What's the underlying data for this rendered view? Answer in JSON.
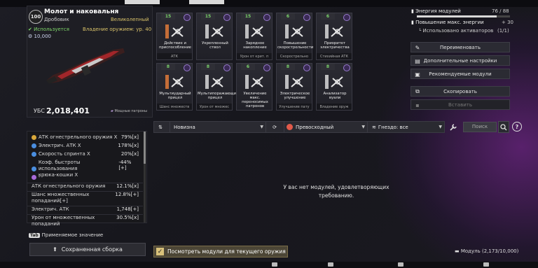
{
  "weapon": {
    "level": "100",
    "name": "Молот и наковальня",
    "type": "Дробовик",
    "rarity": "Великолепный",
    "in_use": "Используется",
    "mastery": "Владение оружием: ур. 40",
    "currency": "10,000",
    "ubs_label": "УБС",
    "ubs_value": "2,018,401",
    "ammo_type": "Мощные патроны"
  },
  "modules": [
    {
      "cap": "15",
      "name": "Действие и\nприспособление",
      "footer": "АТК"
    },
    {
      "cap": "15",
      "name": "Укрепленный\nствол",
      "footer": ""
    },
    {
      "cap": "15",
      "name": "Зарядное\nнакопление",
      "footer": "Урон от крит. п"
    },
    {
      "cap": "6",
      "name": "Повышение\nскорострельности",
      "footer": "Скорострельно"
    },
    {
      "cap": "6",
      "name": "Приоритет\nэлектричества",
      "footer": "Стихийная АТК"
    },
    {
      "cap": "8",
      "name": "Мультиударный\nприцел",
      "footer": "Шанс множеств"
    },
    {
      "cap": "8",
      "name": "Мультипоражающий\nприцел",
      "footer": "Урон от множес"
    },
    {
      "cap": "6",
      "name": "Увеличение\nмакс.\nпереносимых\nпатронов",
      "footer": ""
    },
    {
      "cap": "8",
      "name": "Электрическое\nулучшение",
      "footer": "Улучшение пату"
    },
    {
      "cap": "8",
      "name": "Анализатор\nвуали",
      "footer": "Владение оруж"
    }
  ],
  "stats": [
    {
      "label": "АТК огнестрельного оружия X",
      "value": "79%[x]",
      "icon": "gold"
    },
    {
      "label": "Электрич. АТК X",
      "value": "178%[x]",
      "icon": "blue"
    },
    {
      "label": "Скорость спринта X",
      "value": "20%[x]",
      "icon": "blue"
    },
    {
      "label": "Коэф. быстроты использования\nкрюка-кошки X",
      "value": "-44%[+]",
      "icon": "blue"
    },
    {
      "label": "-",
      "value": "",
      "icon": "purple"
    },
    {
      "label": "АТК огнестрельного оружия",
      "value": "12.1%[x]",
      "icon": ""
    },
    {
      "label": "Шанс множественных\nпопаданий[+]",
      "value": "12.8%[+]",
      "icon": ""
    },
    {
      "label": "Электрич. АТК",
      "value": "1,748[+]",
      "icon": ""
    },
    {
      "label": "Урон от множественных\nпопаданий",
      "value": "30.5%[x]",
      "icon": ""
    }
  ],
  "applied_value": {
    "key": "Tab",
    "label": "Применяемое значение"
  },
  "saved_build": "Сохраненная сборка",
  "right": {
    "energy_label": "Энергия модулей",
    "energy_value": "76 / 88",
    "energy_fraction": 0.86,
    "boost_label": "Повышение макс. энергии",
    "boost_value": "+ 30",
    "activators_label": "Использовано активаторов",
    "activators_value": "(1/1)",
    "buttons": [
      "Переименовать",
      "Дополнительные настройки",
      "Рекомендуемые модули",
      "Скопировать",
      "Вставить"
    ]
  },
  "filter": {
    "sort": "Новизна",
    "grade": "Превосходный",
    "socket": "Гнездо: все",
    "search_placeholder": "Поиск",
    "help": "?"
  },
  "empty_message": "У вас нет модулей, удовлетворяющих требованию.",
  "check_label": "Посмотреть модули для текущего оружия",
  "module_count": "Модуль (2,173/10,000)",
  "colors": {
    "accent_gold": "#d9c26a",
    "green": "#7bd36b",
    "purple_glow": "#8c28aa"
  }
}
